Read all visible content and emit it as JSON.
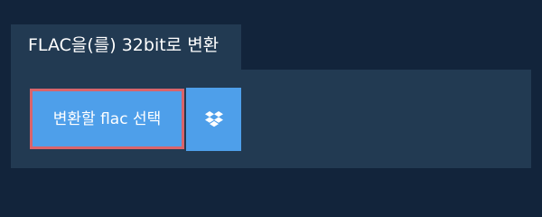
{
  "tab": {
    "label": "FLAC을(를) 32bit로 변환"
  },
  "actions": {
    "select_label": "변환할 flac 선택",
    "dropbox_icon": "dropbox-icon"
  },
  "colors": {
    "background": "#12243b",
    "panel": "#223a52",
    "button": "#4e9fea",
    "highlight_border": "#d9646b",
    "text": "#ffffff"
  }
}
